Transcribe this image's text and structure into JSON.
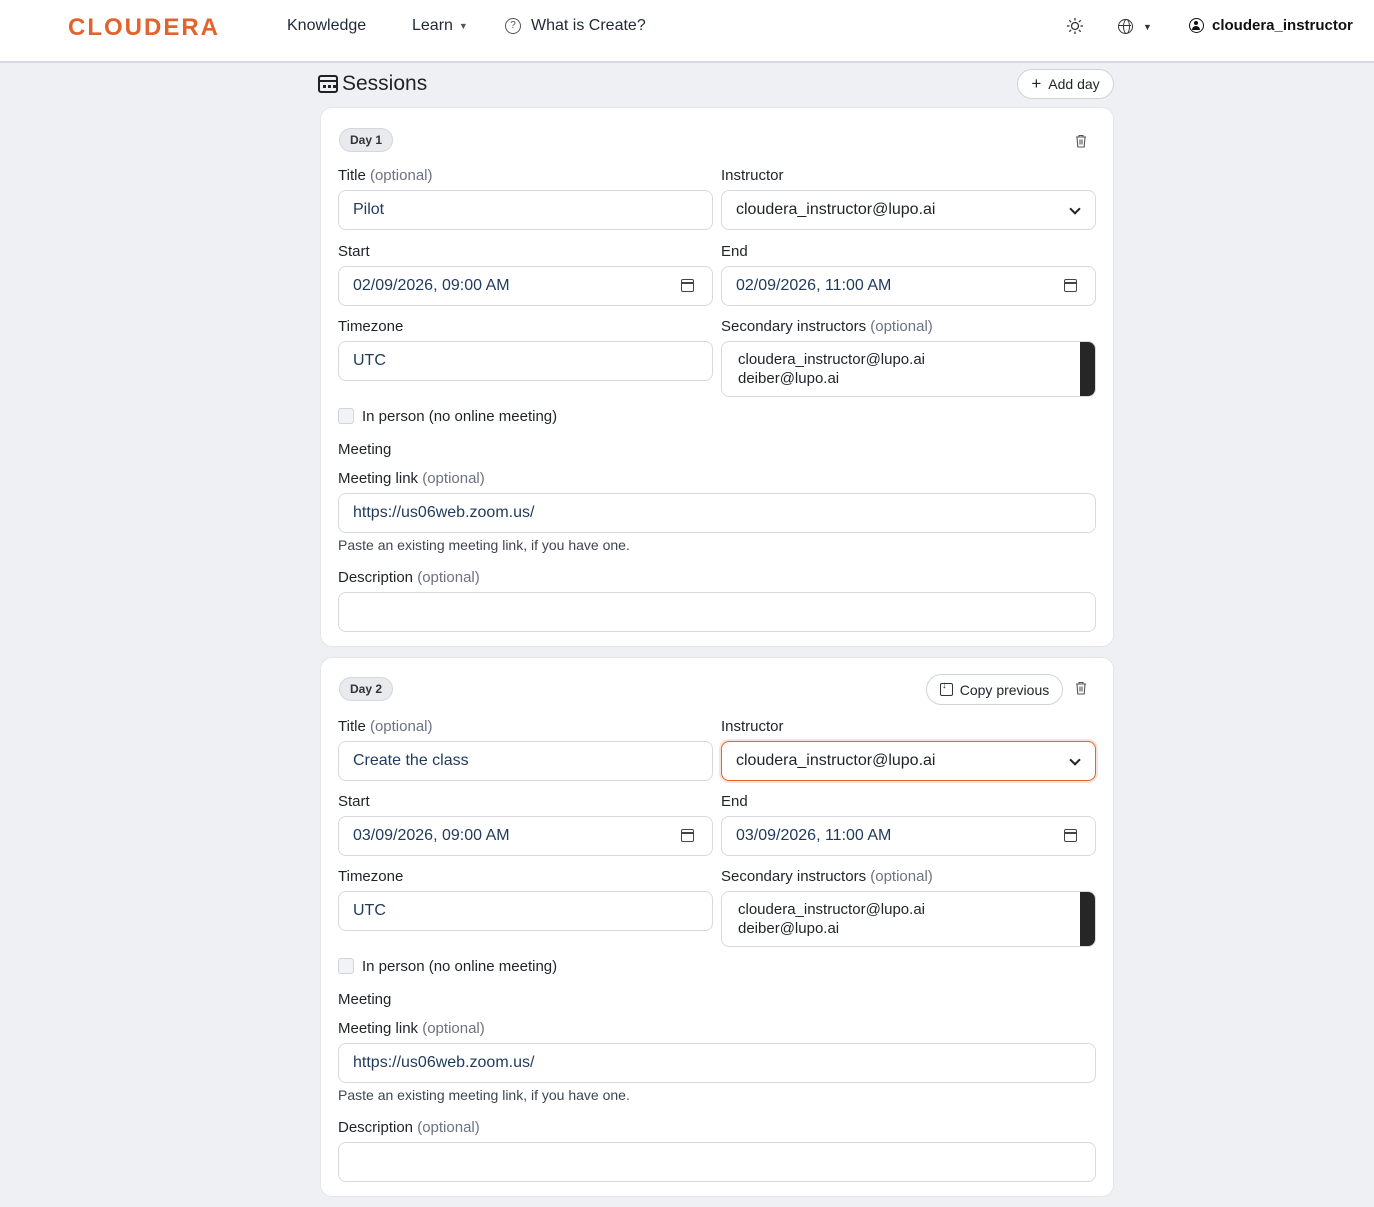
{
  "header": {
    "logo": "CLOUDERA",
    "nav": [
      {
        "label": "Knowledge"
      },
      {
        "label": "Learn"
      },
      {
        "label": "What is Create?"
      }
    ],
    "user": "cloudera_instructor",
    "help_glyph": "?"
  },
  "sessions": {
    "title": "Sessions",
    "add_day_label": "Add day",
    "add_glyph": "+"
  },
  "labels": {
    "title": "Title",
    "optional": "(optional)",
    "instructor": "Instructor",
    "start": "Start",
    "end": "End",
    "timezone": "Timezone",
    "secondary": "Secondary instructors",
    "in_person": "In person (no online meeting)",
    "meeting": "Meeting",
    "meeting_link": "Meeting link",
    "meeting_help": "Paste an existing meeting link, if you have one.",
    "description": "Description",
    "copy_previous": "Copy previous"
  },
  "days": [
    {
      "badge": "Day 1",
      "title": "Pilot",
      "instructor": "cloudera_instructor@lupo.ai",
      "start": "02/09/2026, 09:00 AM",
      "end": "02/09/2026, 11:00 AM",
      "timezone": "UTC",
      "secondary": [
        "cloudera_instructor@lupo.ai",
        "deiber@lupo.ai"
      ],
      "meeting_link": "https://us06web.zoom.us/",
      "description": ""
    },
    {
      "badge": "Day 2",
      "title": "Create the class",
      "instructor": "cloudera_instructor@lupo.ai",
      "start": "03/09/2026, 09:00 AM",
      "end": "03/09/2026, 11:00 AM",
      "timezone": "UTC",
      "secondary": [
        "cloudera_instructor@lupo.ai",
        "deiber@lupo.ai"
      ],
      "meeting_link": "https://us06web.zoom.us/",
      "description": ""
    }
  ],
  "colors": {
    "brand": "#e3632d",
    "background": "#eef0f3",
    "field_text": "#1f3a5a"
  }
}
